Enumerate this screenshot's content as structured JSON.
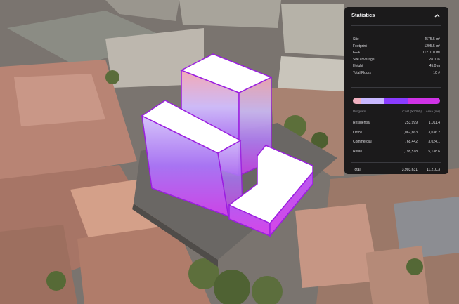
{
  "panel": {
    "title": "Statistics",
    "collapse_icon": "chevron-up-icon"
  },
  "stats": [
    {
      "label": "Site",
      "value": "4575.5 m²"
    },
    {
      "label": "Footprint",
      "value": "1295.5 m²"
    },
    {
      "label": "GFA",
      "value": "11210.0 m²"
    },
    {
      "label": "Site coverage",
      "value": "28.0 %"
    },
    {
      "label": "Height",
      "value": "45.0 m"
    },
    {
      "label": "Total Floors",
      "value": "10 #"
    }
  ],
  "program_table": {
    "headers": {
      "program": "Program",
      "cost": "Cost (¥1000)",
      "area": "Area (m²)"
    },
    "rows": [
      {
        "program": "Residential",
        "cost": "253,999",
        "area": "1,011.4",
        "color": "#f0b0c0"
      },
      {
        "program": "Office",
        "cost": "1,062,663",
        "area": "3,036.2",
        "color": "#c8b8ff"
      },
      {
        "program": "Commercial",
        "cost": "768,442",
        "area": "3,024.1",
        "color": "#8a3cff"
      },
      {
        "program": "Retail",
        "cost": "1,798,518",
        "area": "5,138.6",
        "color": "#cf33e6"
      }
    ],
    "total": {
      "label": "Total",
      "cost": "3,903,631",
      "area": "11,210.3"
    }
  },
  "program_mix_shares": [
    0.09,
    0.27,
    0.27,
    0.37
  ],
  "colors": {
    "panel_bg": "#121214",
    "accent_purple": "#a020f0",
    "accent_pink": "#f0b0c0"
  }
}
